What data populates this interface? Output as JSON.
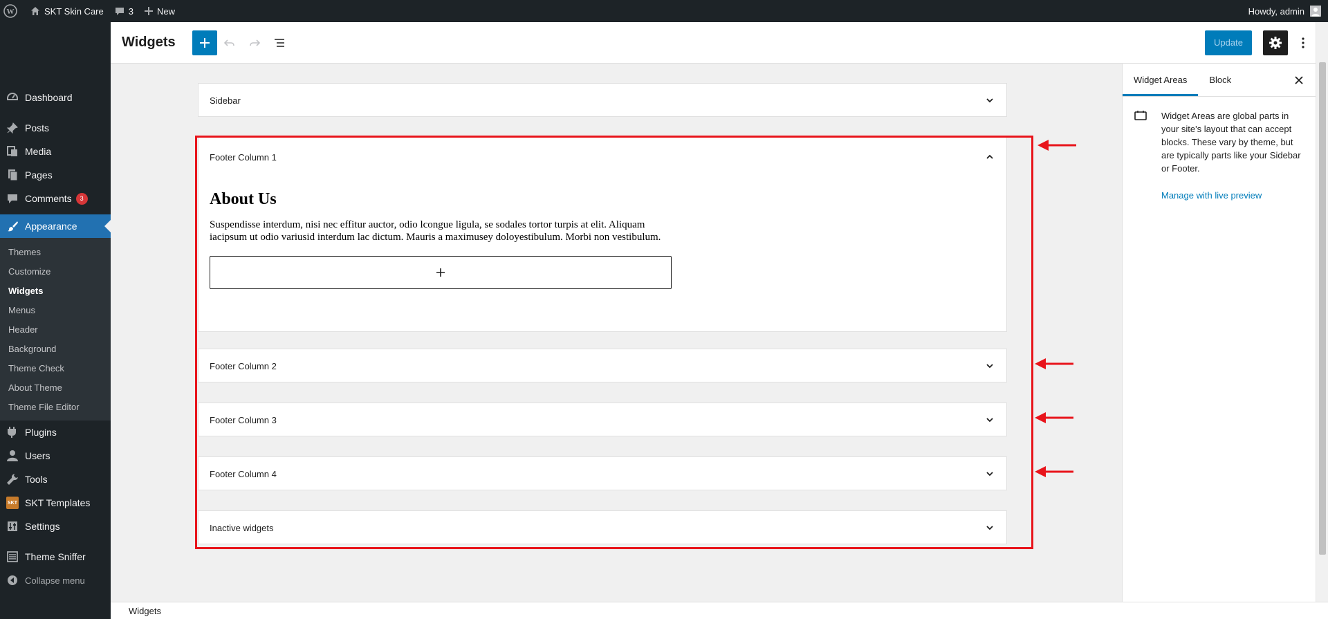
{
  "admin_bar": {
    "site_name": "SKT Skin Care",
    "comments_count": "3",
    "new_label": "New",
    "greeting": "Howdy, admin"
  },
  "menu": {
    "dashboard": "Dashboard",
    "posts": "Posts",
    "media": "Media",
    "pages": "Pages",
    "comments": "Comments",
    "comments_badge": "3",
    "appearance": "Appearance",
    "sub": [
      "Themes",
      "Customize",
      "Widgets",
      "Menus",
      "Header",
      "Background",
      "Theme Check",
      "About Theme",
      "Theme File Editor"
    ],
    "plugins": "Plugins",
    "users": "Users",
    "tools": "Tools",
    "skt_templates": "SKT Templates",
    "skt_logo_text": "SKT",
    "settings": "Settings",
    "theme_sniffer": "Theme Sniffer",
    "collapse": "Collapse menu"
  },
  "header": {
    "title": "Widgets",
    "update_label": "Update"
  },
  "widget_areas": {
    "sidebar": "Sidebar",
    "footer1": "Footer Column 1",
    "footer2": "Footer Column 2",
    "footer3": "Footer Column 3",
    "footer4": "Footer Column 4",
    "inactive": "Inactive widgets"
  },
  "about": {
    "heading": "About Us",
    "paragraph": "Suspendisse interdum, nisi nec effitur auctor, odio lcongue ligula, se sodales tortor turpis at elit. Aliquam iacipsum ut odio variusid interdum lac dictum. Mauris a maximusey doloyestibulum. Morbi non vestibulum."
  },
  "sidebar_panel": {
    "tab_widget_areas": "Widget Areas",
    "tab_block": "Block",
    "description": "Widget Areas are global parts in your site's layout that can accept blocks. These vary by theme, but are typically parts like your Sidebar or Footer.",
    "link": "Manage with live preview"
  },
  "footer": {
    "breadcrumb": "Widgets"
  },
  "colors": {
    "accent": "#007cba",
    "admin_dark": "#1d2327",
    "highlight_red": "#e8141b",
    "menu_current": "#2271b1"
  }
}
